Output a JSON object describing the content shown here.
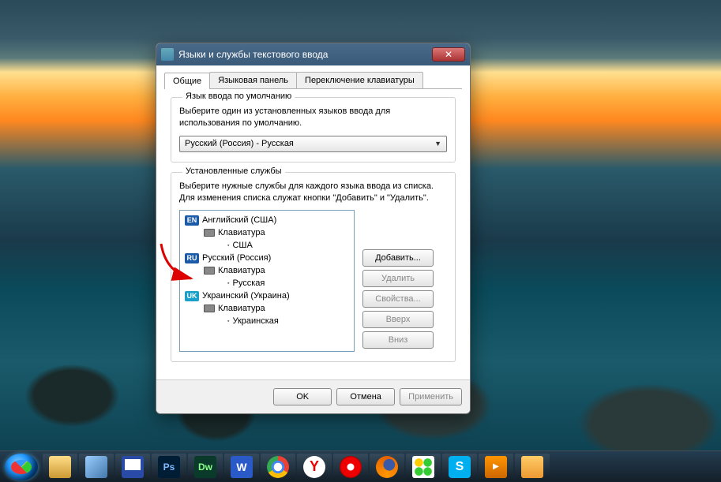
{
  "dialog": {
    "title": "Языки и службы текстового ввода",
    "tabs": [
      {
        "label": "Общие",
        "active": true
      },
      {
        "label": "Языковая панель",
        "active": false
      },
      {
        "label": "Переключение клавиатуры",
        "active": false
      }
    ],
    "default_lang_group": {
      "title": "Язык ввода по умолчанию",
      "hint": "Выберите один из установленных языков ввода для использования по умолчанию.",
      "selected": "Русский (Россия) - Русская"
    },
    "services_group": {
      "title": "Установленные службы",
      "hint": "Выберите нужные службы для каждого языка ввода из списка. Для изменения списка служат кнопки \"Добавить\" и \"Удалить\".",
      "languages": [
        {
          "badge": "EN",
          "badgeClass": "badge-en",
          "name": "Английский (США)",
          "kbLabel": "Клавиатура",
          "layouts": [
            "США"
          ]
        },
        {
          "badge": "RU",
          "badgeClass": "badge-ru",
          "name": "Русский (Россия)",
          "kbLabel": "Клавиатура",
          "layouts": [
            "Русская"
          ]
        },
        {
          "badge": "UK",
          "badgeClass": "badge-uk",
          "name": "Украинский (Украина)",
          "kbLabel": "Клавиатура",
          "layouts": [
            "Украинская"
          ]
        }
      ],
      "buttons": {
        "add": "Добавить...",
        "remove": "Удалить",
        "properties": "Свойства...",
        "up": "Вверх",
        "down": "Вниз"
      }
    },
    "footer": {
      "ok": "OK",
      "cancel": "Отмена",
      "apply": "Применить"
    }
  },
  "taskbar": {
    "items": [
      {
        "name": "explorer",
        "cls": "ic-explorer",
        "txt": ""
      },
      {
        "name": "notepad",
        "cls": "ic-note",
        "txt": ""
      },
      {
        "name": "save",
        "cls": "ic-save",
        "txt": ""
      },
      {
        "name": "photoshop",
        "cls": "ic-ps",
        "txt": "Ps"
      },
      {
        "name": "dreamweaver",
        "cls": "ic-dw",
        "txt": "Dw"
      },
      {
        "name": "word",
        "cls": "ic-word",
        "txt": "W"
      },
      {
        "name": "chrome",
        "cls": "ic-chrome",
        "txt": ""
      },
      {
        "name": "yandex",
        "cls": "ic-yandex",
        "txt": "Y"
      },
      {
        "name": "opera",
        "cls": "ic-opera",
        "txt": ""
      },
      {
        "name": "firefox",
        "cls": "ic-firefox",
        "txt": ""
      },
      {
        "name": "icq",
        "cls": "ic-icq",
        "txt": ""
      },
      {
        "name": "skype",
        "cls": "ic-skype",
        "txt": "S"
      },
      {
        "name": "media-player",
        "cls": "ic-media",
        "txt": ""
      },
      {
        "name": "lang-settings",
        "cls": "ic-lang",
        "txt": ""
      }
    ]
  }
}
